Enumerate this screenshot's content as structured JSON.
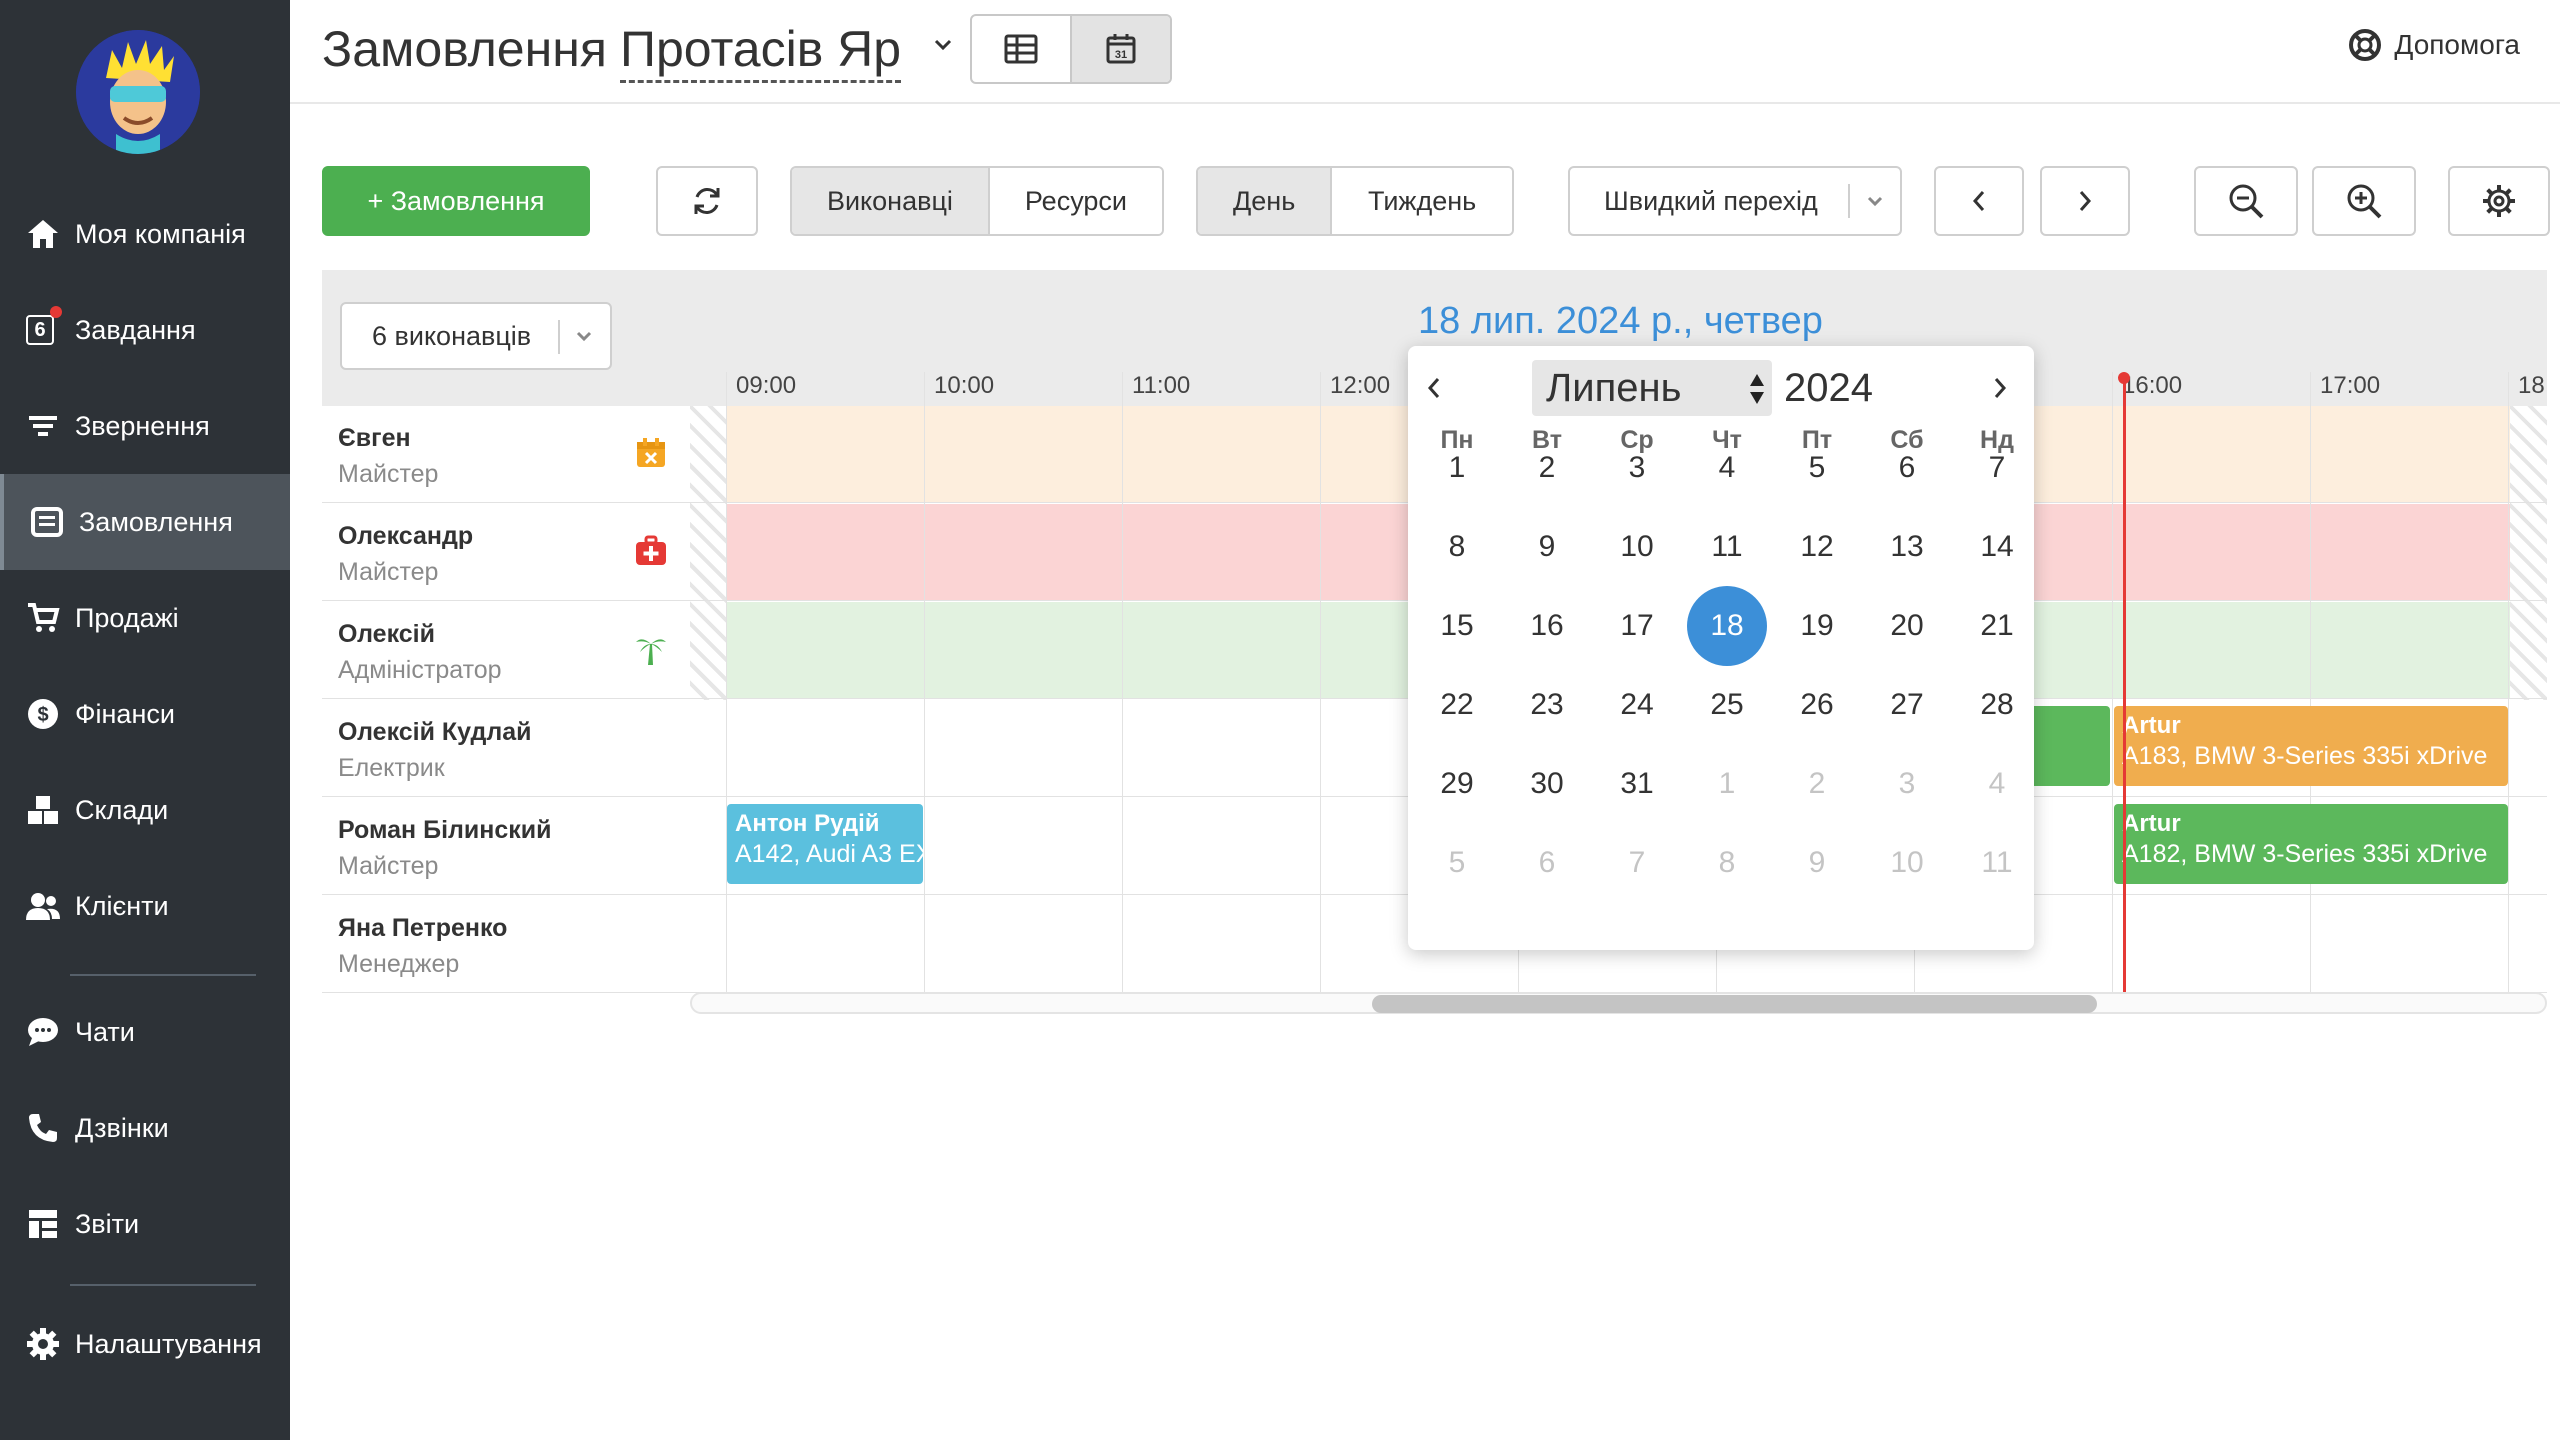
{
  "sidebar": {
    "items": [
      {
        "label": "Моя компанія",
        "icon": "home-icon"
      },
      {
        "label": "Завдання",
        "icon": "tasks-icon",
        "badge": "6"
      },
      {
        "label": "Звернення",
        "icon": "filter-icon"
      },
      {
        "label": "Замовлення",
        "icon": "orders-icon",
        "active": true
      },
      {
        "label": "Продажі",
        "icon": "cart-icon"
      },
      {
        "label": "Фінанси",
        "icon": "dollar-icon"
      },
      {
        "label": "Склади",
        "icon": "boxes-icon"
      },
      {
        "label": "Клієнти",
        "icon": "users-icon"
      },
      {
        "label": "Чати",
        "icon": "chat-icon"
      },
      {
        "label": "Дзвінки",
        "icon": "phone-icon"
      },
      {
        "label": "Звіти",
        "icon": "reports-icon"
      },
      {
        "label": "Налаштування",
        "icon": "gear-icon"
      }
    ]
  },
  "header": {
    "title": "Замовлення",
    "location": "Протасів Яр",
    "help": "Допомога"
  },
  "toolbar": {
    "add_order": "+ Замовлення",
    "performers": "Виконавці",
    "resources": "Ресурси",
    "day": "День",
    "week": "Тиждень",
    "quick_jump": "Швидкий перехід"
  },
  "scheduler": {
    "filter": "6 виконавців",
    "date_title": "18 лип. 2024 р., четвер",
    "times": [
      "09:00",
      "10:00",
      "11:00",
      "12:00",
      "16:00",
      "17:00",
      "18"
    ],
    "employees": [
      {
        "name": "Євген",
        "role": "Майстер",
        "status_icon": "calendar-x-icon",
        "color": "#f5a623"
      },
      {
        "name": "Олександр",
        "role": "Майстер",
        "status_icon": "first-aid-icon",
        "color": "#e53935"
      },
      {
        "name": "Олексій",
        "role": "Адміністратор",
        "status_icon": "palm-tree-icon",
        "color": "#4caf50"
      },
      {
        "name": "Олексій Кудлай",
        "role": "Електрик"
      },
      {
        "name": "Роман Білинский",
        "role": "Майстер"
      },
      {
        "name": "Яна Петренко",
        "role": "Менеджер"
      }
    ],
    "events": [
      {
        "name": "Антон Рудій",
        "detail": "A142, Audi A3 EX",
        "color": "#5bc0de"
      },
      {
        "name": "Artur",
        "detail": "A183, BMW 3-Series 335i xDrive",
        "color": "#f0ad4e"
      },
      {
        "name": "Artur",
        "detail": "A182, BMW 3-Series 335i xDrive",
        "color": "#5cb85c"
      }
    ]
  },
  "datepicker": {
    "month": "Липень",
    "year": "2024",
    "weekdays": [
      "Пн",
      "Вт",
      "Ср",
      "Чт",
      "Пт",
      "Сб",
      "Нд"
    ],
    "weeks": [
      [
        "1",
        "2",
        "3",
        "4",
        "5",
        "6",
        "7"
      ],
      [
        "8",
        "9",
        "10",
        "11",
        "12",
        "13",
        "14"
      ],
      [
        "15",
        "16",
        "17",
        "18",
        "19",
        "20",
        "21"
      ],
      [
        "22",
        "23",
        "24",
        "25",
        "26",
        "27",
        "28"
      ],
      [
        "29",
        "30",
        "31",
        "1",
        "2",
        "3",
        "4"
      ],
      [
        "5",
        "6",
        "7",
        "8",
        "9",
        "10",
        "11"
      ]
    ],
    "selected": "18"
  }
}
